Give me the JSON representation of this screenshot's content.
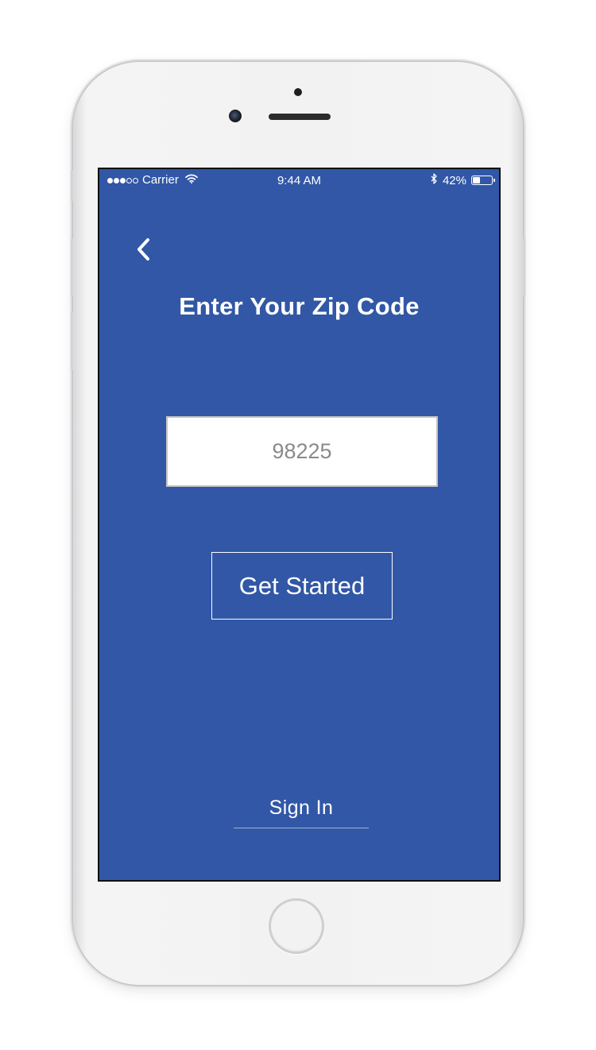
{
  "status_bar": {
    "carrier": "Carrier",
    "signal_bars_filled": 3,
    "signal_bars_total": 5,
    "time": "9:44 AM",
    "battery_percent": "42%",
    "battery_level": 0.42,
    "icons": [
      "wifi-icon",
      "bluetooth-icon",
      "battery-icon"
    ]
  },
  "header": {
    "back_icon": "chevron-left-icon",
    "title": "Enter Your Zip Code"
  },
  "zip_field": {
    "placeholder": "98225",
    "value": ""
  },
  "actions": {
    "get_started_label": "Get Started",
    "sign_in_label": "Sign In"
  },
  "colors": {
    "background": "#3157a6",
    "text": "#ffffff",
    "input_background": "#ffffff",
    "input_text": "#8a8a8a"
  }
}
